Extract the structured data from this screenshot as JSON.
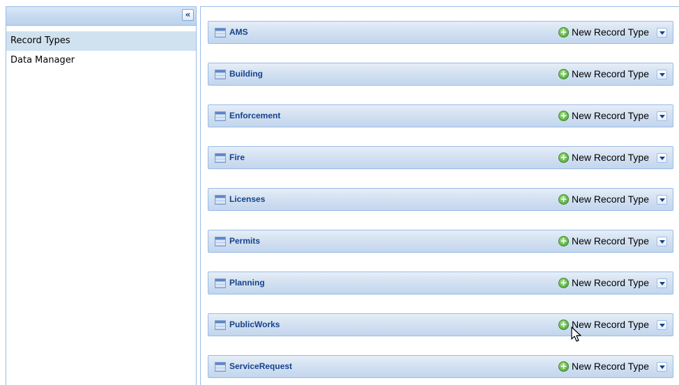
{
  "sidebar": {
    "collapse_glyph": "«",
    "items": [
      {
        "label": "Record Types",
        "selected": true
      },
      {
        "label": "Data Manager",
        "selected": false
      }
    ]
  },
  "panels": [
    {
      "title": "AMS",
      "action": "New Record Type"
    },
    {
      "title": "Building",
      "action": "New Record Type"
    },
    {
      "title": "Enforcement",
      "action": "New Record Type"
    },
    {
      "title": "Fire",
      "action": "New Record Type"
    },
    {
      "title": "Licenses",
      "action": "New Record Type"
    },
    {
      "title": "Permits",
      "action": "New Record Type"
    },
    {
      "title": "Planning",
      "action": "New Record Type"
    },
    {
      "title": "PublicWorks",
      "action": "New Record Type"
    },
    {
      "title": "ServiceRequest",
      "action": "New Record Type"
    }
  ],
  "icons": {
    "collapse": "double-chevron-left-icon",
    "panel": "grid-icon",
    "add": "plus-circle-icon",
    "menu": "chevron-down-icon"
  },
  "colors": {
    "header_text": "#15428b",
    "border": "#99bbe8",
    "selected_bg": "#d0e2f0",
    "add_green": "#3f9b2a"
  }
}
